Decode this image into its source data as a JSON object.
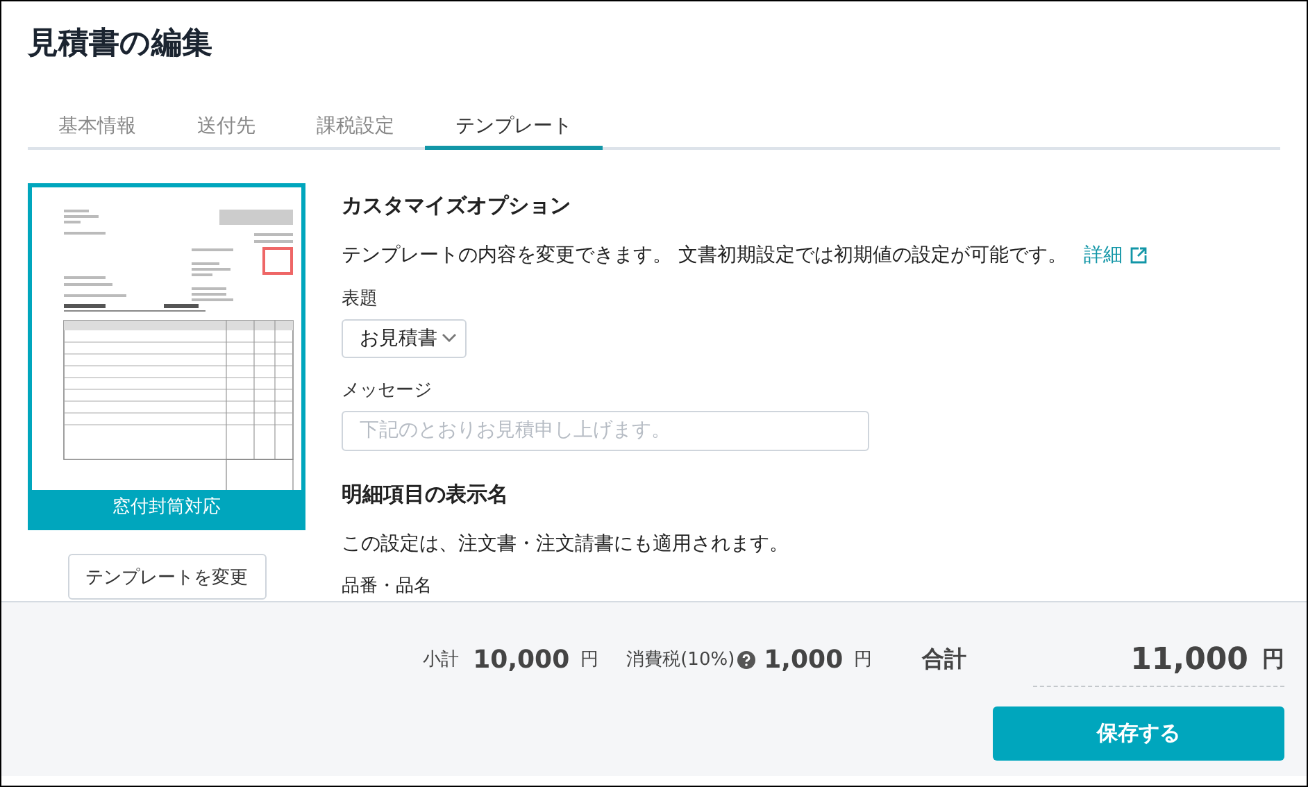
{
  "title": "見積書の編集",
  "tabs": [
    {
      "label": "基本情報",
      "selected": false
    },
    {
      "label": "送付先",
      "selected": false
    },
    {
      "label": "課税設定",
      "selected": false
    },
    {
      "label": "テンプレート",
      "selected": true
    }
  ],
  "template": {
    "caption": "窓付封筒対応",
    "change_button": "テンプレートを変更"
  },
  "options": {
    "heading": "カスタマイズオプション",
    "description": "テンプレートの内容を変更できます。 文書初期設定では初期値の設定が可能です。",
    "detail_link": "詳細",
    "title_label": "表題",
    "title_select": {
      "value": "お見積書"
    },
    "message_label": "メッセージ",
    "message_field": {
      "placeholder": "下記のとおりお見積申し上げます。"
    },
    "items_heading": "明細項目の表示名",
    "items_note": "この設定は、注文書・注文請書にも適用されます。",
    "item_name_label": "品番・品名"
  },
  "totals": {
    "subtotal_label": "小計",
    "subtotal": "10,000",
    "subtotal_unit": "円",
    "tax_label": "消費税(10%)",
    "tax": "1,000",
    "tax_unit": "円",
    "total_label": "合計",
    "total": "11,000",
    "total_unit": "円"
  },
  "save_button": "保存する"
}
